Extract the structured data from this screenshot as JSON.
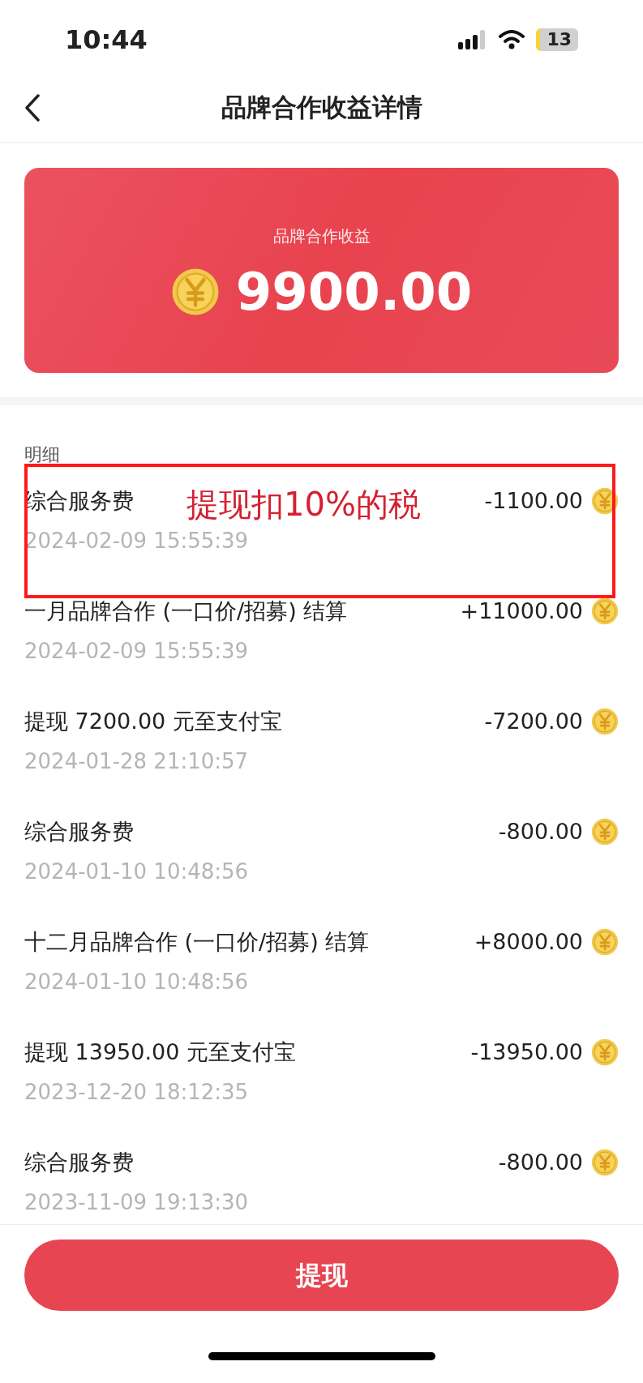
{
  "status_bar": {
    "time": "10:44",
    "battery": "13"
  },
  "nav": {
    "title": "品牌合作收益详情"
  },
  "summary": {
    "label": "品牌合作收益",
    "amount": "9900.00"
  },
  "details": {
    "heading": "明细",
    "rows": [
      {
        "title": "综合服务费",
        "date": "2024-02-09 15:55:39",
        "amount": "-1100.00",
        "annotation": "提现扣10%的税"
      },
      {
        "title": "一月品牌合作 (一口价/招募) 结算",
        "date": "2024-02-09 15:55:39",
        "amount": "+11000.00"
      },
      {
        "title": "提现 7200.00 元至支付宝",
        "date": "2024-01-28 21:10:57",
        "amount": "-7200.00"
      },
      {
        "title": "综合服务费",
        "date": "2024-01-10 10:48:56",
        "amount": "-800.00"
      },
      {
        "title": "十二月品牌合作 (一口价/招募) 结算",
        "date": "2024-01-10 10:48:56",
        "amount": "+8000.00"
      },
      {
        "title": "提现 13950.00 元至支付宝",
        "date": "2023-12-20 18:12:35",
        "amount": "-13950.00"
      },
      {
        "title": "综合服务费",
        "date": "2023-11-09 19:13:30",
        "amount": "-800.00"
      }
    ]
  },
  "action": {
    "label": "提现"
  }
}
